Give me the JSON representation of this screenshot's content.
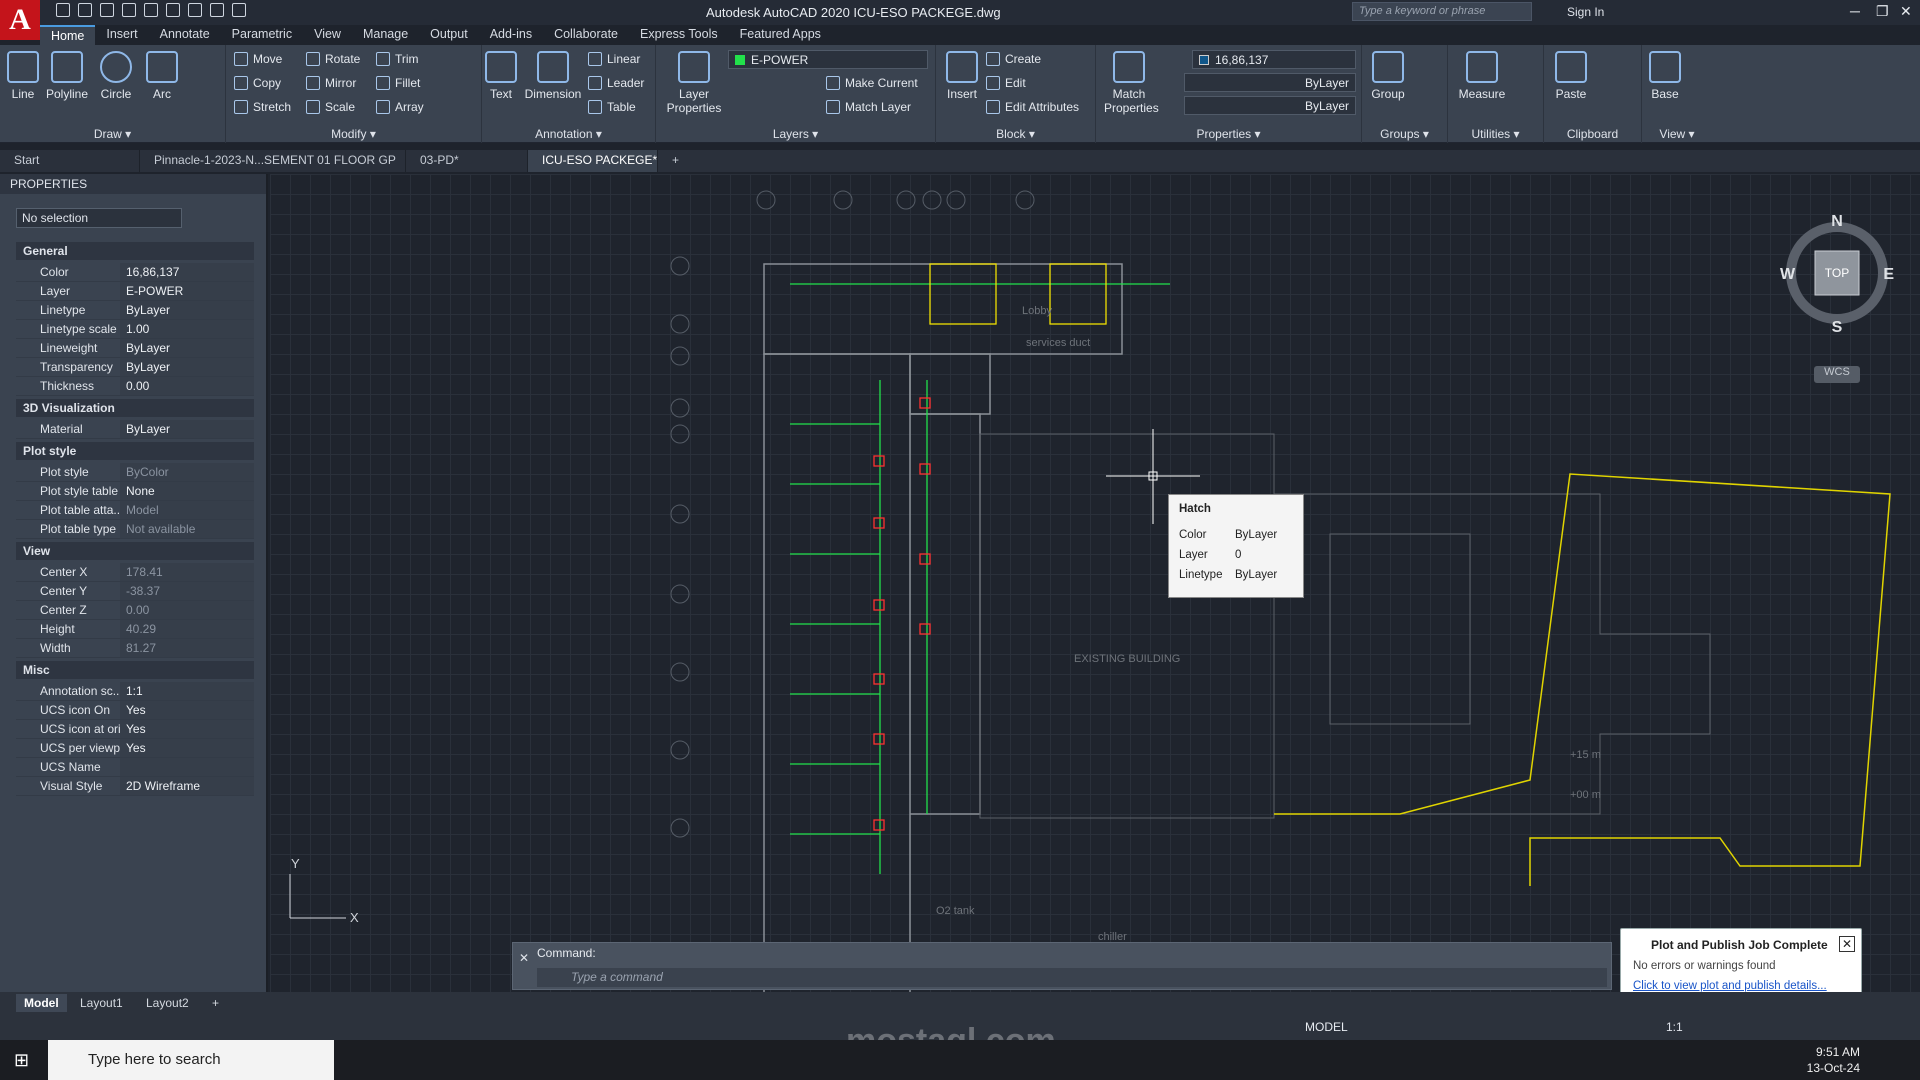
{
  "app": {
    "window_title": "Autodesk AutoCAD 2020   ICU-ESO PACKEGE.dwg",
    "logo": "A",
    "search_placeholder": "Type a keyword or phrase",
    "sign_in": "Sign In"
  },
  "menu": [
    "Home",
    "Insert",
    "Annotate",
    "Parametric",
    "View",
    "Manage",
    "Output",
    "Add-ins",
    "Collaborate",
    "Express Tools",
    "Featured Apps"
  ],
  "ribbon": {
    "draw": {
      "label": "Draw ▾",
      "line": "Line",
      "polyline": "Polyline",
      "circle": "Circle",
      "arc": "Arc"
    },
    "modify": {
      "label": "Modify ▾",
      "move": "Move",
      "rotate": "Rotate",
      "trim": "Trim",
      "copy": "Copy",
      "mirror": "Mirror",
      "fillet": "Fillet",
      "stretch": "Stretch",
      "scale": "Scale",
      "array": "Array"
    },
    "annotation": {
      "label": "Annotation ▾",
      "text": "Text",
      "dimension": "Dimension",
      "linear": "Linear",
      "leader": "Leader",
      "table": "Table"
    },
    "layers": {
      "label": "Layers ▾",
      "properties": "Layer Properties",
      "current": "E-POWER",
      "make_current": "Make Current",
      "match_layer": "Match Layer"
    },
    "block": {
      "label": "Block ▾",
      "insert": "Insert",
      "create": "Create",
      "edit": "Edit",
      "edit_attributes": "Edit Attributes"
    },
    "properties": {
      "label": "Properties ▾",
      "match": "Match Properties",
      "color": "16,86,137",
      "linetype": "ByLayer",
      "lineweight": "ByLayer"
    },
    "groups": {
      "label": "Groups ▾",
      "group": "Group"
    },
    "utilities": {
      "label": "Utilities ▾",
      "measure": "Measure"
    },
    "clipboard": {
      "label": "Clipboard",
      "paste": "Paste"
    },
    "view": {
      "label": "View ▾",
      "base": "Base"
    }
  },
  "doc_tabs": [
    "Start",
    "Pinnacle-1-2023-N...SEMENT 01 FLOOR GP",
    "03-PD*",
    "ICU-ESO PACKEGE*"
  ],
  "properties_panel": {
    "title": "PROPERTIES",
    "selection": "No selection",
    "general": {
      "title": "General",
      "rows": [
        [
          "Color",
          "16,86,137"
        ],
        [
          "Layer",
          "E-POWER"
        ],
        [
          "Linetype",
          "ByLayer"
        ],
        [
          "Linetype scale",
          "1.00"
        ],
        [
          "Lineweight",
          "ByLayer"
        ],
        [
          "Transparency",
          "ByLayer"
        ],
        [
          "Thickness",
          "0.00"
        ]
      ]
    },
    "viz": {
      "title": "3D Visualization",
      "rows": [
        [
          "Material",
          "ByLayer"
        ]
      ]
    },
    "plot": {
      "title": "Plot style",
      "rows": [
        [
          "Plot style",
          "ByColor"
        ],
        [
          "Plot style table",
          "None"
        ],
        [
          "Plot table atta...",
          "Model"
        ],
        [
          "Plot table type",
          "Not available"
        ]
      ]
    },
    "view": {
      "title": "View",
      "rows": [
        [
          "Center X",
          "178.41"
        ],
        [
          "Center Y",
          "-38.37"
        ],
        [
          "Center Z",
          "0.00"
        ],
        [
          "Height",
          "40.29"
        ],
        [
          "Width",
          "81.27"
        ]
      ]
    },
    "misc": {
      "title": "Misc",
      "rows": [
        [
          "Annotation sc...",
          "1:1"
        ],
        [
          "UCS icon On",
          "Yes"
        ],
        [
          "UCS icon at ori...",
          "Yes"
        ],
        [
          "UCS per viewp...",
          "Yes"
        ],
        [
          "UCS Name",
          ""
        ],
        [
          "Visual Style",
          "2D Wireframe"
        ]
      ]
    }
  },
  "tooltip": {
    "title": "Hatch",
    "rows": [
      [
        "Color",
        "ByLayer"
      ],
      [
        "Layer",
        "0"
      ],
      [
        "Linetype",
        "ByLayer"
      ]
    ]
  },
  "viewcube": {
    "n": "N",
    "s": "S",
    "e": "E",
    "w": "W",
    "top": "TOP",
    "wcs": "WCS"
  },
  "drawing_labels": [
    "Lobby",
    "services duct",
    "EXISTING BUILDING",
    "O2 tank",
    "chiller",
    "+15 m",
    "+00 m"
  ],
  "command": {
    "history": "Command:",
    "placeholder": "Type a command"
  },
  "layout_tabs": [
    "Model",
    "Layout1",
    "Layout2"
  ],
  "status": {
    "model": "MODEL",
    "scale": "1:1"
  },
  "notification": {
    "title": "Plot and Publish Job Complete",
    "message": "No errors or warnings found",
    "link": "Click to view plot and publish details..."
  },
  "taskbar": {
    "search": "Type here to search",
    "time": "9:51 AM",
    "date": "13-Oct-24"
  },
  "watermark": "mostaql.com",
  "colors": {
    "accent": "#c4141b",
    "ribbon": "#3a4350",
    "canvas": "#1f242d",
    "green": "#22e04b",
    "red": "#ff3030",
    "yellow": "#f0e000"
  }
}
